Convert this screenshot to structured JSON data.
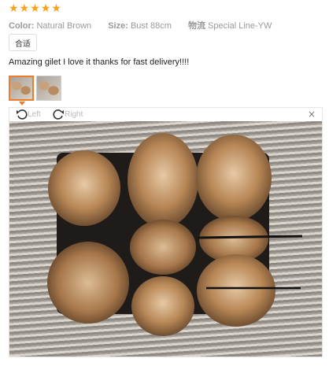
{
  "rating": {
    "stars": 5,
    "star_color": "#f7a21a"
  },
  "meta": {
    "color_label": "Color:",
    "color_value": "Natural Brown",
    "size_label": "Size:",
    "size_value": "Bust 88cm",
    "logistics_label": "物流",
    "logistics_value": "Special Line-YW"
  },
  "tag": "合适",
  "review_text": "Amazing gilet I love it thanks for fast delivery!!!!",
  "thumbnails": {
    "count": 2,
    "active_index": 0,
    "accent": "#f07c28"
  },
  "viewer": {
    "rotate_left_label": "Left",
    "rotate_right_label": "Right",
    "close_symbol": "×",
    "image_alt": "fur gilet photo"
  }
}
